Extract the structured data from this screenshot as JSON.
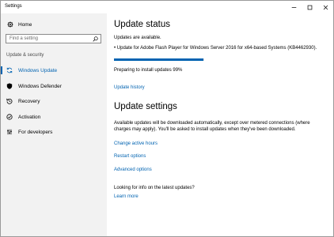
{
  "window": {
    "title": "Settings"
  },
  "sidebar": {
    "home_label": "Home",
    "search_placeholder": "Find a setting",
    "section_label": "Update & security",
    "items": [
      {
        "label": "Windows Update",
        "icon": "sync-icon",
        "active": true
      },
      {
        "label": "Windows Defender",
        "icon": "shield-icon",
        "active": false
      },
      {
        "label": "Recovery",
        "icon": "history-icon",
        "active": false
      },
      {
        "label": "Activation",
        "icon": "check-circle-icon",
        "active": false
      },
      {
        "label": "For developers",
        "icon": "sliders-icon",
        "active": false
      }
    ]
  },
  "update_status": {
    "heading": "Update status",
    "available_text": "Updates are available.",
    "update_item": "• Update for Adobe Flash Player for Windows Server 2016 for x64-based Systems (KB4462930).",
    "progress_fraction": 0.99,
    "progress_text": "Preparing to install updates 99%",
    "history_link": "Update history"
  },
  "update_settings": {
    "heading": "Update settings",
    "description": "Available updates will be downloaded automatically, except over metered connections (where charges may apply). You'll be asked to install updates when they've been downloaded.",
    "active_hours_link": "Change active hours",
    "restart_link": "Restart options",
    "advanced_link": "Advanced options"
  },
  "info": {
    "question": "Looking for info on the latest updates?",
    "learn_more_link": "Learn more"
  },
  "colors": {
    "accent": "#0063b1",
    "sidebar_bg": "#f2f2f2"
  }
}
